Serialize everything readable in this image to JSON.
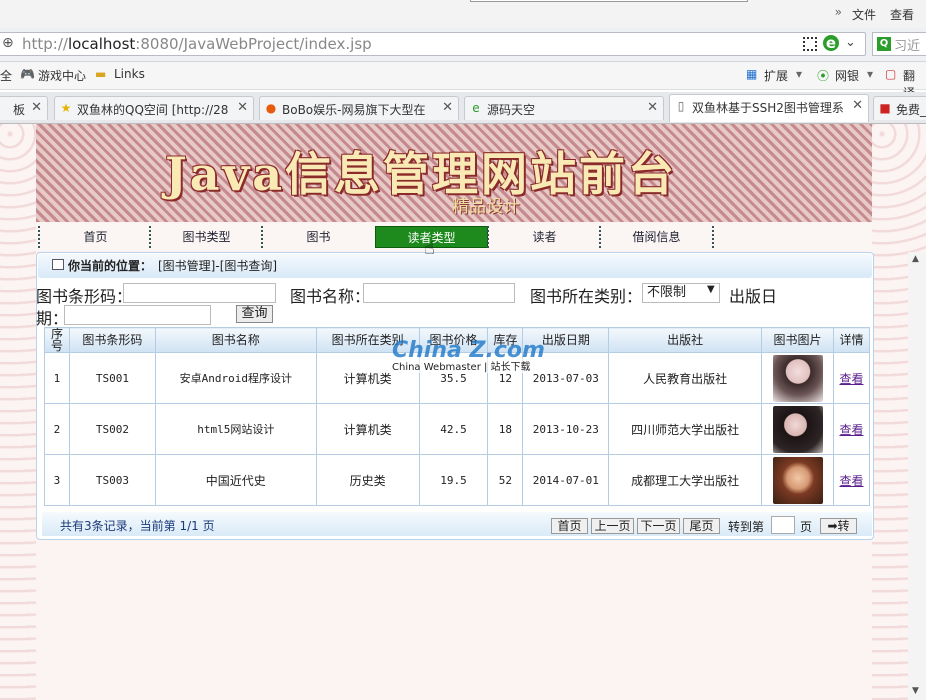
{
  "browser": {
    "menu_arrow": "»",
    "menu_file": "文件",
    "menu_view": "查看",
    "address_prefix": "http://",
    "address_host": "localhost",
    "address_rest": ":8080/JavaWebProject/index.jsp",
    "search_placeholder": "习近",
    "favorites": [
      "全",
      "游戏中心",
      "Links"
    ],
    "fav_right": [
      "扩展",
      "网银",
      "翻译"
    ],
    "tabs": [
      {
        "label": "板",
        "icon": "blank-icon"
      },
      {
        "label": "双鱼林的QQ空间 [http://28",
        "icon": "star-icon"
      },
      {
        "label": "BoBo娱乐-网易旗下大型在",
        "icon": "bobo-icon"
      },
      {
        "label": "源码天空",
        "icon": "ie-icon"
      },
      {
        "label": "双鱼林基于SSH2图书管理系",
        "icon": "page-icon"
      },
      {
        "label": "免费_",
        "icon": "red-icon"
      }
    ]
  },
  "site": {
    "title": "Java信息管理网站前台",
    "subtitle": "精品设计",
    "nav": [
      "首页",
      "图书类型",
      "图书",
      "读者类型",
      "读者",
      "借阅信息"
    ],
    "active_nav": "读者类型"
  },
  "panel": {
    "location_label": "你当前的位置：",
    "location_path": "[图书管理]-[图书查询]",
    "search": {
      "barcode_label": "图书条形码：",
      "name_label": "图书名称：",
      "category_label": "图书所在类别：",
      "category_value": "不限制",
      "date_label_1": "出版日",
      "date_label_2": "期：",
      "query_button": "查询"
    },
    "table": {
      "headers": [
        "序号",
        "图书条形码",
        "图书名称",
        "图书所在类别",
        "图书价格",
        "库存",
        "出版日期",
        "出版社",
        "图书图片",
        "详情"
      ],
      "rows": [
        {
          "no": "1",
          "barcode": "TS001",
          "name": "安卓Android程序设计",
          "category": "计算机类",
          "price": "35.5",
          "stock": "12",
          "date": "2013-07-03",
          "publisher": "人民教育出版社",
          "detail": "查看"
        },
        {
          "no": "2",
          "barcode": "TS002",
          "name": "html5网站设计",
          "category": "计算机类",
          "price": "42.5",
          "stock": "18",
          "date": "2013-10-23",
          "publisher": "四川师范大学出版社",
          "detail": "查看"
        },
        {
          "no": "3",
          "barcode": "TS003",
          "name": "中国近代史",
          "category": "历史类",
          "price": "19.5",
          "stock": "52",
          "date": "2014-07-01",
          "publisher": "成都理工大学出版社",
          "detail": "查看"
        }
      ]
    },
    "pager": {
      "info": "共有3条记录，当前第 1/1 页",
      "first": "首页",
      "prev": "上一页",
      "next": "下一页",
      "last": "尾页",
      "goto_label": "转到第",
      "page_label": "页",
      "go": "➡转"
    }
  },
  "watermark": {
    "main": "China Z.com",
    "sub": "China Webmaster | 站长下载"
  }
}
